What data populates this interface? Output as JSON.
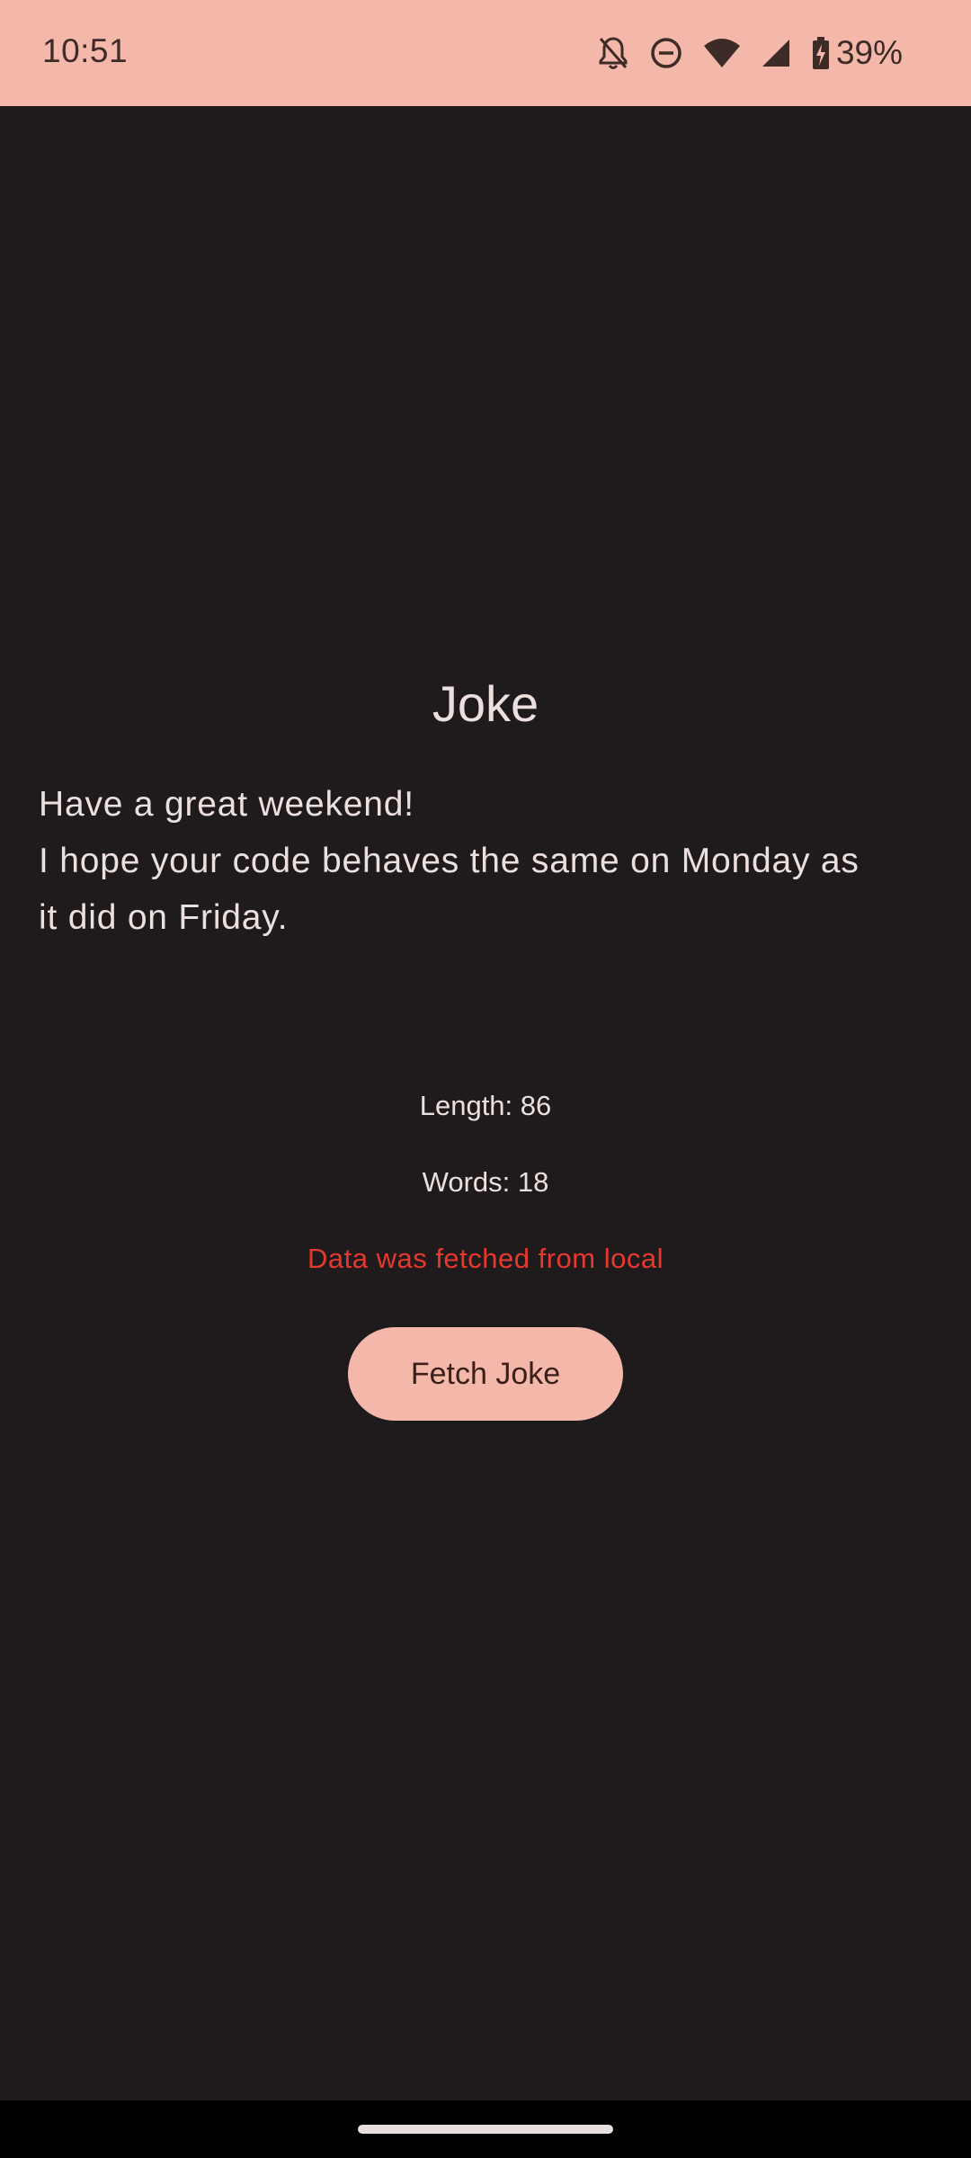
{
  "status_bar": {
    "time": "10:51",
    "battery_percent": "39%",
    "icons": [
      "notifications-off-icon",
      "do-not-disturb-icon",
      "wifi-icon",
      "cell-signal-icon",
      "battery-charging-icon"
    ],
    "background_color": "#f4b8aa"
  },
  "main": {
    "title": "Joke",
    "joke_lines": [
      "Have a great weekend!",
      "I hope your code behaves the same on Monday as",
      "it did on Friday."
    ],
    "length_text": "Length: 86",
    "words_text": "Words: 18",
    "source_text": "Data was fetched from local",
    "source_color": "#e5392e",
    "fetch_button_label": "Fetch Joke",
    "accent_color": "#f4b8aa"
  },
  "navigation": {
    "handle": "gesture-handle"
  }
}
